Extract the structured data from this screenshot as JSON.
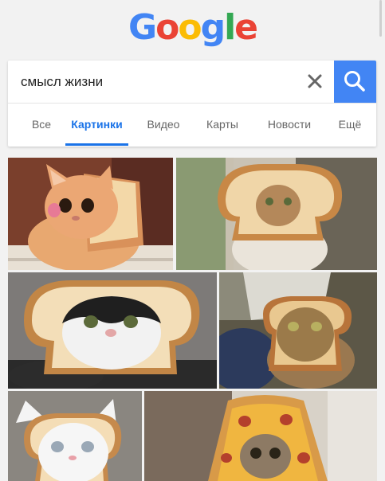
{
  "logo": {
    "letters": [
      "G",
      "o",
      "o",
      "g",
      "l",
      "e"
    ]
  },
  "search": {
    "query": "смысл жизни"
  },
  "tabs": [
    {
      "label": "Все"
    },
    {
      "label": "Картинки"
    },
    {
      "label": "Видео"
    },
    {
      "label": "Карты"
    },
    {
      "label": "Новости"
    },
    {
      "label": "Ещё"
    }
  ],
  "active_tab": "Картинки",
  "colors": {
    "google_blue": "#4285f4",
    "google_red": "#ea4335",
    "google_yellow": "#fbbc05",
    "google_green": "#34a853",
    "active_tab": "#1a73e8"
  },
  "icons": [
    "clear-icon",
    "search-icon"
  ],
  "results": [
    {
      "name": "image-result-1"
    },
    {
      "name": "image-result-2"
    },
    {
      "name": "image-result-3"
    },
    {
      "name": "image-result-4"
    },
    {
      "name": "image-result-5"
    },
    {
      "name": "image-result-6"
    }
  ]
}
